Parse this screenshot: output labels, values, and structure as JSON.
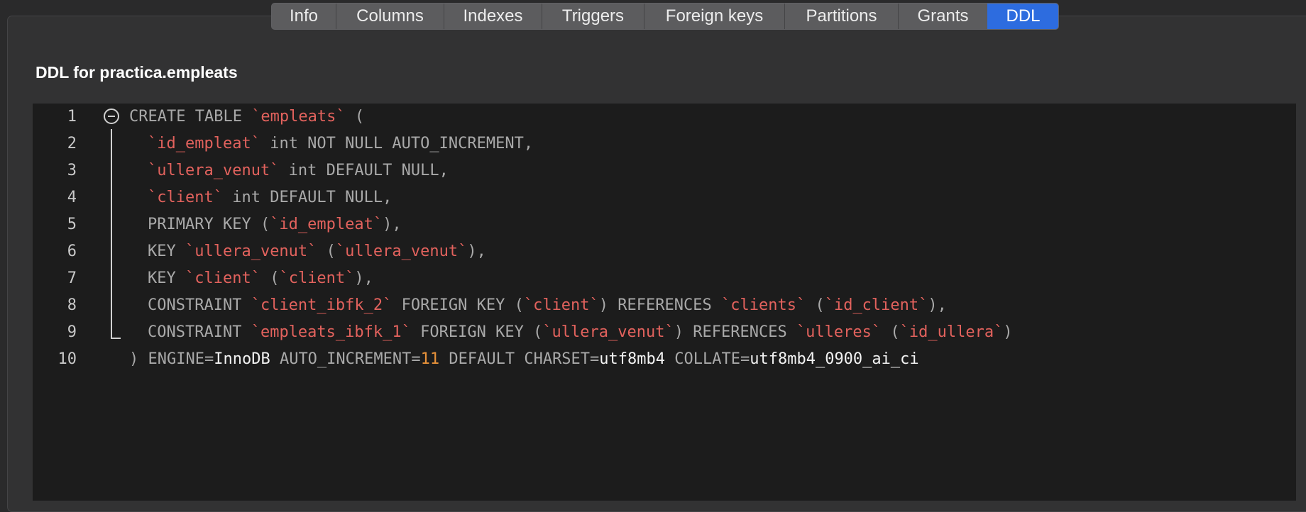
{
  "tabs": [
    {
      "label": "Info"
    },
    {
      "label": "Columns"
    },
    {
      "label": "Indexes"
    },
    {
      "label": "Triggers"
    },
    {
      "label": "Foreign keys"
    },
    {
      "label": "Partitions"
    },
    {
      "label": "Grants"
    },
    {
      "label": "DDL"
    }
  ],
  "active_tab": "DDL",
  "ddl": {
    "title": "DDL for practica.empleats",
    "lines": [
      {
        "number": "1",
        "tokens": [
          [
            "kw",
            "CREATE TABLE "
          ],
          [
            "id",
            "`empleats`"
          ],
          [
            "kw",
            " ("
          ]
        ]
      },
      {
        "number": "2",
        "tokens": [
          [
            "id",
            "`id_empleat`"
          ],
          [
            "kw",
            " int NOT NULL AUTO_INCREMENT,"
          ]
        ]
      },
      {
        "number": "3",
        "tokens": [
          [
            "id",
            "`ullera_venut`"
          ],
          [
            "kw",
            " int DEFAULT NULL,"
          ]
        ]
      },
      {
        "number": "4",
        "tokens": [
          [
            "id",
            "`client`"
          ],
          [
            "kw",
            " int DEFAULT NULL,"
          ]
        ]
      },
      {
        "number": "5",
        "tokens": [
          [
            "kw",
            "PRIMARY KEY ("
          ],
          [
            "id",
            "`id_empleat`"
          ],
          [
            "kw",
            "),"
          ]
        ]
      },
      {
        "number": "6",
        "tokens": [
          [
            "kw",
            "KEY "
          ],
          [
            "id",
            "`ullera_venut`"
          ],
          [
            "kw",
            " ("
          ],
          [
            "id",
            "`ullera_venut`"
          ],
          [
            "kw",
            "),"
          ]
        ]
      },
      {
        "number": "7",
        "tokens": [
          [
            "kw",
            "KEY "
          ],
          [
            "id",
            "`client`"
          ],
          [
            "kw",
            " ("
          ],
          [
            "id",
            "`client`"
          ],
          [
            "kw",
            "),"
          ]
        ]
      },
      {
        "number": "8",
        "tokens": [
          [
            "kw",
            "CONSTRAINT "
          ],
          [
            "id",
            "`client_ibfk_2`"
          ],
          [
            "kw",
            " FOREIGN KEY ("
          ],
          [
            "id",
            "`client`"
          ],
          [
            "kw",
            ") REFERENCES "
          ],
          [
            "id",
            "`clients`"
          ],
          [
            "kw",
            " ("
          ],
          [
            "id",
            "`id_client`"
          ],
          [
            "kw",
            "),"
          ]
        ]
      },
      {
        "number": "9",
        "tokens": [
          [
            "kw",
            "CONSTRAINT "
          ],
          [
            "id",
            "`empleats_ibfk_1`"
          ],
          [
            "kw",
            " FOREIGN KEY ("
          ],
          [
            "id",
            "`ullera_venut`"
          ],
          [
            "kw",
            ") REFERENCES "
          ],
          [
            "id",
            "`ulleres`"
          ],
          [
            "kw",
            " ("
          ],
          [
            "id",
            "`id_ullera`"
          ],
          [
            "kw",
            ")"
          ]
        ]
      },
      {
        "number": "10",
        "tokens": [
          [
            "kw",
            ") ENGINE="
          ],
          [
            "val",
            "InnoDB"
          ],
          [
            "kw",
            " AUTO_INCREMENT="
          ],
          [
            "num",
            "11"
          ],
          [
            "kw",
            " DEFAULT CHARSET="
          ],
          [
            "val",
            "utf8mb4"
          ],
          [
            "kw",
            " COLLATE="
          ],
          [
            "val",
            "utf8mb4_0900_ai_ci"
          ]
        ]
      }
    ]
  },
  "icons": {
    "fold": "collapse-circle-minus-icon"
  },
  "colors": {
    "active_tab": "#2d6cdf",
    "identifier": "#e2625d",
    "keyword": "#a9a9a9",
    "number": "#e8923a",
    "value": "#f2f2f2"
  }
}
